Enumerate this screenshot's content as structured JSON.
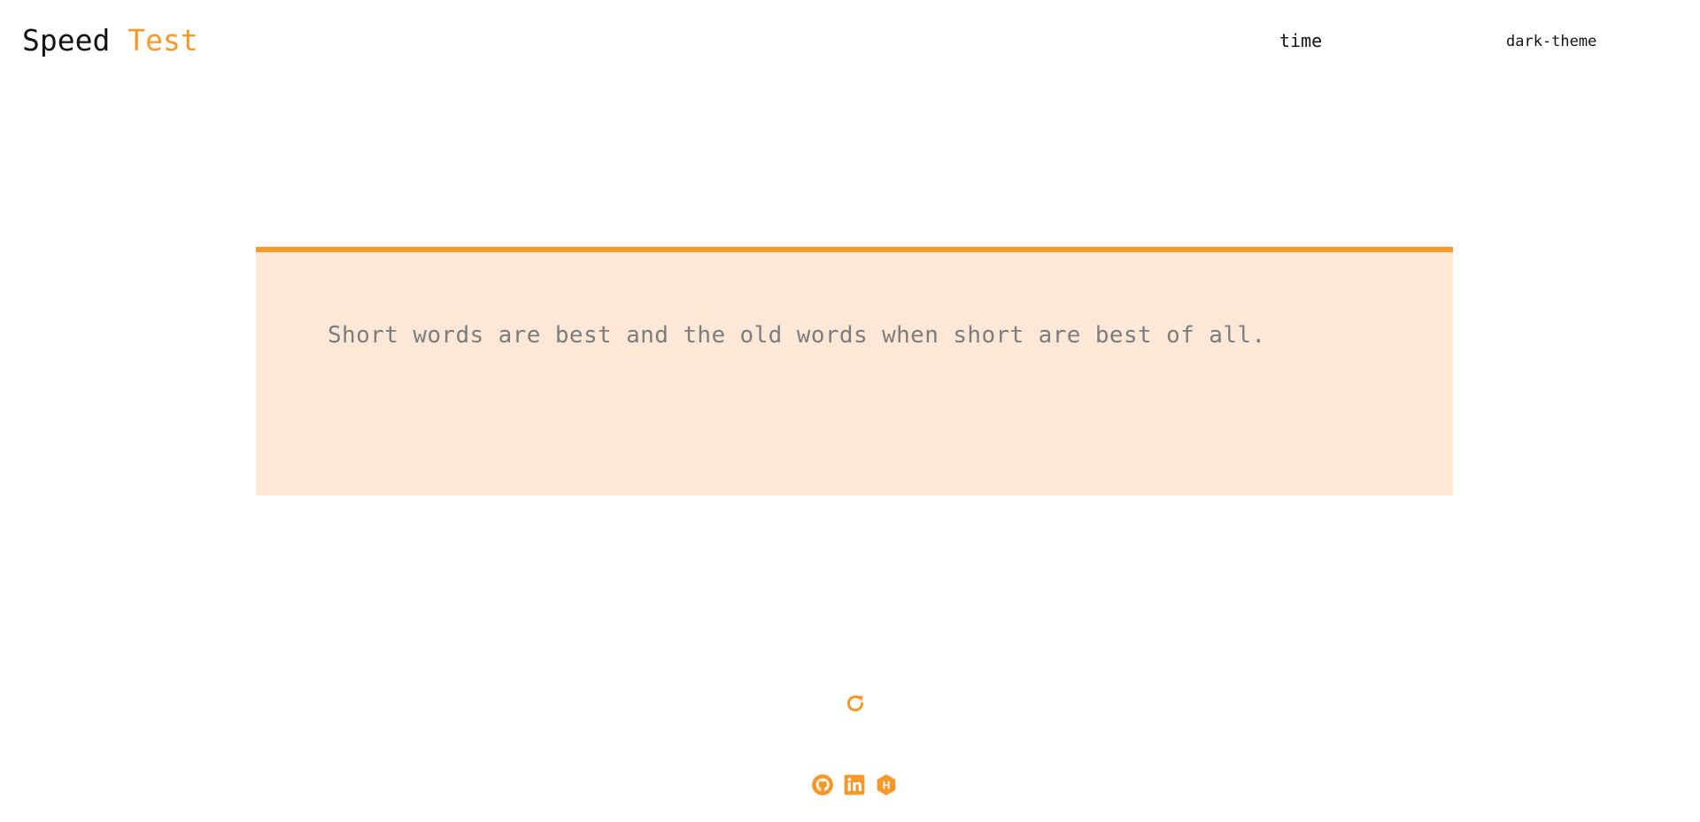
{
  "header": {
    "logo_word1": "Speed",
    "logo_word2": "Test",
    "nav_time": "time",
    "nav_theme": "dark-theme"
  },
  "typing": {
    "quote": "Short words are best and the old words when short are best of all."
  },
  "controls": {
    "reload_icon": "reload-icon"
  },
  "footer": {
    "icons": [
      "github-icon",
      "linkedin-icon",
      "hashnode-icon"
    ]
  },
  "colors": {
    "accent": "#f7982a",
    "box_background": "#fde7d6",
    "text_muted": "#7d7d7d",
    "text_dark": "#111111"
  }
}
